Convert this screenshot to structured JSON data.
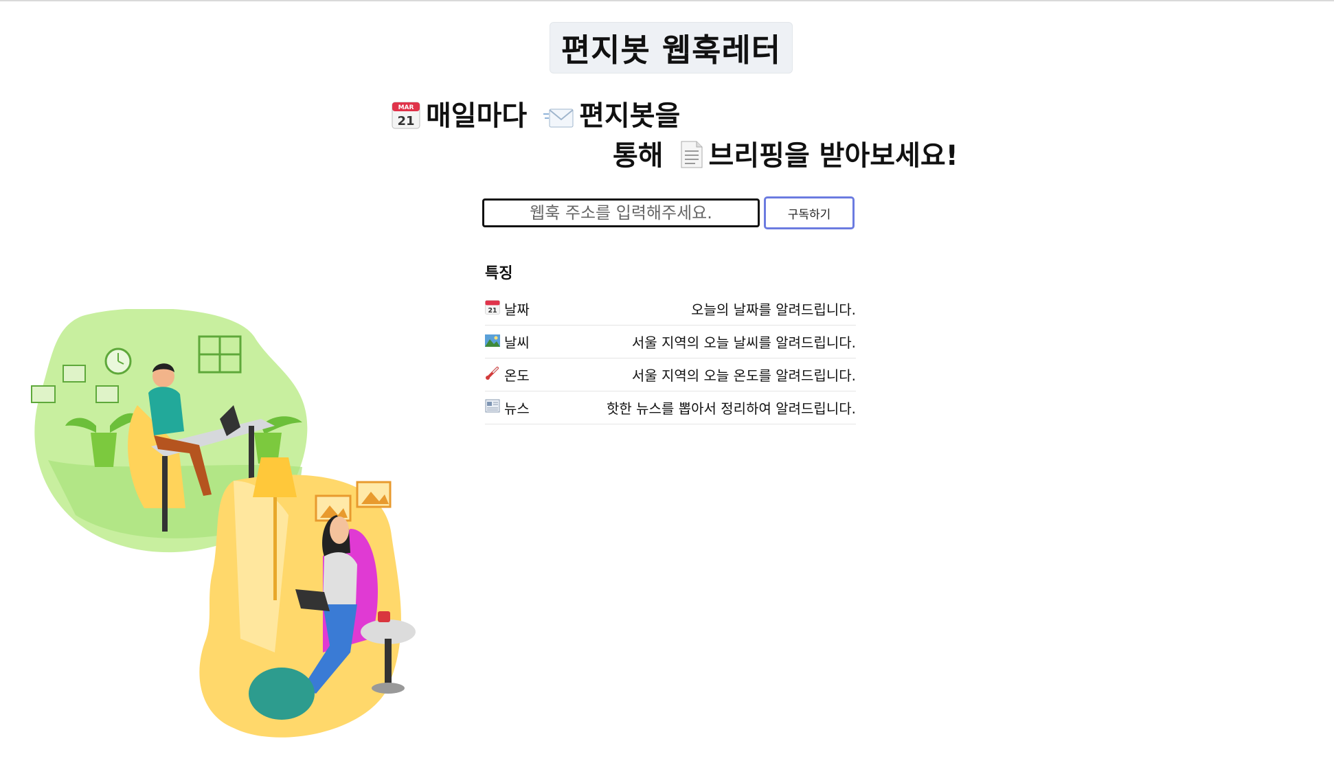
{
  "page": {
    "title": "편지봇 웹훅레터",
    "headline": {
      "line1_emoji1": "calendar-icon",
      "line1_text1": "매일마다",
      "line1_emoji2": "envelope-icon",
      "line1_text2": "편지봇을",
      "line2_text1": "통해",
      "line2_emoji": "document-icon",
      "line2_text2": "브리핑을 받아보세요!"
    }
  },
  "subscribe": {
    "placeholder": "웹훅 주소를 입력해주세요.",
    "button_label": "구독하기"
  },
  "features": {
    "heading": "특징",
    "items": [
      {
        "icon": "calendar-icon",
        "name": "날짜",
        "description": "오늘의 날짜를 알려드립니다."
      },
      {
        "icon": "landscape-icon",
        "name": "날씨",
        "description": "서울 지역의 오늘 날씨를 알려드립니다."
      },
      {
        "icon": "thermometer-icon",
        "name": "온도",
        "description": "서울 지역의 오늘 온도를 알려드립니다."
      },
      {
        "icon": "newspaper-icon",
        "name": "뉴스",
        "description": "핫한 뉴스를 뽑아서 정리하여 알려드립니다."
      }
    ]
  },
  "colors": {
    "accent_button_border": "#6b7be0",
    "title_bg": "#eef1f5",
    "illustration_green": "#c8ef9f",
    "illustration_yellow": "#ffd86b"
  }
}
